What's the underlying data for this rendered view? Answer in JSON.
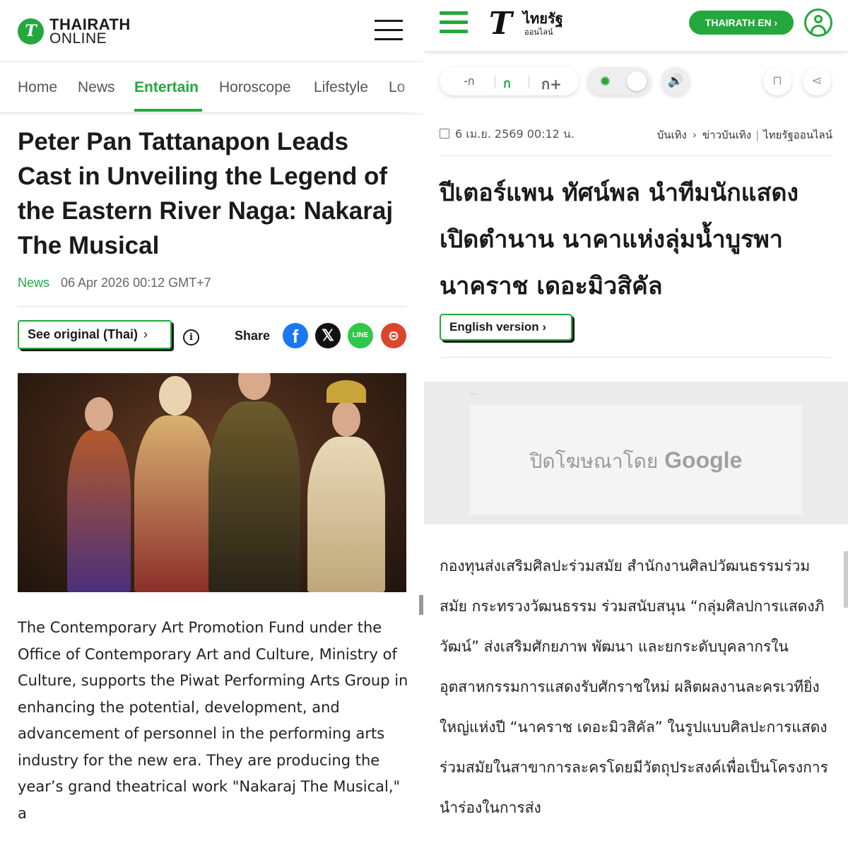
{
  "left": {
    "logo": {
      "line1": "THAIRATH",
      "line2": "ONLINE",
      "mark": "T"
    },
    "nav": {
      "items": [
        "Home",
        "News",
        "Entertain",
        "Horoscope",
        "Lifestyle",
        "Lo"
      ],
      "active": "Entertain"
    },
    "article": {
      "title": "Peter Pan Tattanapon Leads Cast in Unveiling the Legend of the Eastern River Naga: Nakaraj The Musical",
      "category": "News",
      "date": "06 Apr 2026 00:12 GMT+7",
      "original_button": "See original (Thai)",
      "share_label": "Share",
      "body": "The Contemporary Art Promotion Fund under the Office of Contemporary Art and Culture, Ministry of Culture, supports the Piwat Performing Arts Group in enhancing the potential, development, and advancement of personnel in the performing arts industry for the new era. They are producing the year’s grand theatrical work \"Nakaraj The Musical,\" a"
    },
    "social_icons": [
      "facebook-icon",
      "x-icon",
      "line-icon",
      "link-icon"
    ],
    "social_text": {
      "fb": "f",
      "x": "𝕏",
      "line": "LINE",
      "link": "⊝"
    }
  },
  "right": {
    "logo": {
      "mark": "T",
      "line1": "ไทยรัฐ",
      "line2": "ออนไลน์"
    },
    "en_button": "THAIRATH EN",
    "font_sizes": [
      "-ก",
      "ก",
      "ก+"
    ],
    "date": "6 เม.ย. 2569 00:12 น.",
    "breadcrumb": [
      "บันเทิง",
      "ข่าวบันเทิง",
      "ไทยรัฐออนไลน์"
    ],
    "title": "ปีเตอร์แพน ทัศน์พล นำทีมนักแสดง เปิดตำนาน นาคาแห่งลุ่มน้ำบูรพา นาคราช เดอะมิวสิคัล",
    "english_button": "English version",
    "ad": {
      "dots": "...",
      "text": "ปิดโฆษณาโดย",
      "brand": "Google"
    },
    "body": "กองทุนส่งเสริมศิลปะร่วมสมัย สำนักงานศิลปวัฒนธรรมร่วมสมัย กระทรวงวัฒนธรรม ร่วมสนับสนุน “กลุ่มศิลปการแสดงภิวัฒน์” ส่งเสริมศักยภาพ พัฒนา และยกระดับบุคลากรในอุตสาหกรรมการแสดงรับศักราชใหม่ ผลิตผลงานละครเวทียิ่งใหญ่แห่งปี “นาคราช เดอะมิวสิคัล” ในรูปแบบศิลปะการแสดงร่วมสมัยในสาขาการละครโดยมีวัตถุประสงค์เพื่อเป็นโครงการนำร่องในการส่ง"
  },
  "colors": {
    "brand_green": "#24a83d",
    "text": "#1a1a1a",
    "muted": "#666666"
  }
}
